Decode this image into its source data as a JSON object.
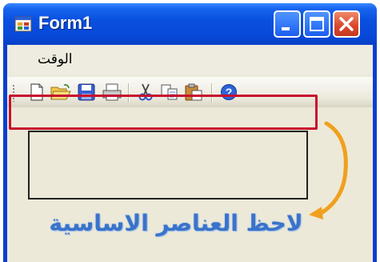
{
  "window": {
    "title": "Form1",
    "buttons": [
      "minimize",
      "maximize",
      "close"
    ]
  },
  "menu": {
    "items": [
      {
        "label": "الوقت"
      }
    ]
  },
  "toolbar": {
    "tools": [
      {
        "name": "new-icon"
      },
      {
        "name": "open-icon"
      },
      {
        "name": "save-icon"
      },
      {
        "name": "print-icon"
      },
      {
        "name": "cut-icon"
      },
      {
        "name": "copy-icon"
      },
      {
        "name": "paste-icon"
      },
      {
        "name": "help-icon"
      }
    ]
  },
  "annotation": {
    "text": "لاحظ العناصر الاساسية",
    "highlight_color": "#c8102e",
    "arrow_color": "#f0a01e"
  },
  "colors": {
    "titlebar": "#0a50e0",
    "client": "#ede9d8",
    "close_button": "#d9452a"
  }
}
